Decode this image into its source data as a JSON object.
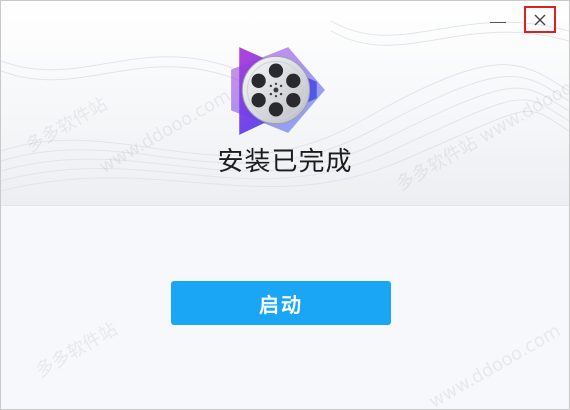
{
  "window": {
    "status_title": "安装已完成",
    "launch_label": "启动",
    "minimize_label": "—",
    "close_label": "×"
  },
  "logo": {
    "icon": "film-reel-icon",
    "colors": {
      "purple": "#8a2be2",
      "blue": "#2f80ed",
      "reel": "#e8e8e8"
    }
  },
  "watermarks": [
    "多多软件站",
    "www.ddooo.com",
    "多多软件站 www.ddooo.com"
  ],
  "colors": {
    "accent": "#1aa6f5",
    "close_highlight": "#e02020"
  }
}
